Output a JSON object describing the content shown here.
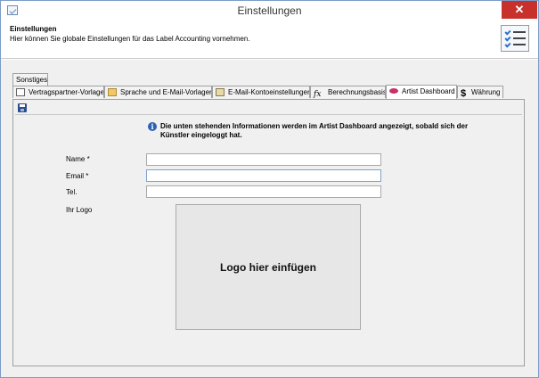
{
  "window": {
    "title": "Einstellungen",
    "close_glyph": "✕"
  },
  "header": {
    "title": "Einstellungen",
    "description": "Hier können Sie globale Einstellungen für das Label Accounting vornehmen.",
    "icon": "checklist-icon"
  },
  "tabs": {
    "row1": [
      {
        "label": "Sonstiges",
        "icon": null
      }
    ],
    "row2": [
      {
        "label": "Vertragspartner-Vorlage",
        "icon": "contract-icon"
      },
      {
        "label": "Sprache und E-Mail-Vorlagen",
        "icon": "mail-icon"
      },
      {
        "label": "E-Mail-Kontoeinstellungen",
        "icon": "mail-settings-icon"
      },
      {
        "label": "Berechnungsbasis",
        "icon": "function-icon"
      },
      {
        "label": "Artist Dashboard",
        "icon": "dashboard-icon",
        "active": true
      },
      {
        "label": "Währung",
        "icon": "dollar-icon"
      }
    ]
  },
  "artist_dashboard": {
    "save_icon": "save-icon",
    "info": "Die unten stehenden Informationen werden im Artist Dashboard angezeigt, sobald sich der Künstler eingeloggt hat.",
    "fields": {
      "name": {
        "label": "Name *",
        "value": ""
      },
      "email": {
        "label": "Email *",
        "value": ""
      },
      "tel": {
        "label": "Tel.",
        "value": ""
      }
    },
    "logo_label": "Ihr Logo",
    "logo_placeholder": "Logo hier einfügen"
  }
}
